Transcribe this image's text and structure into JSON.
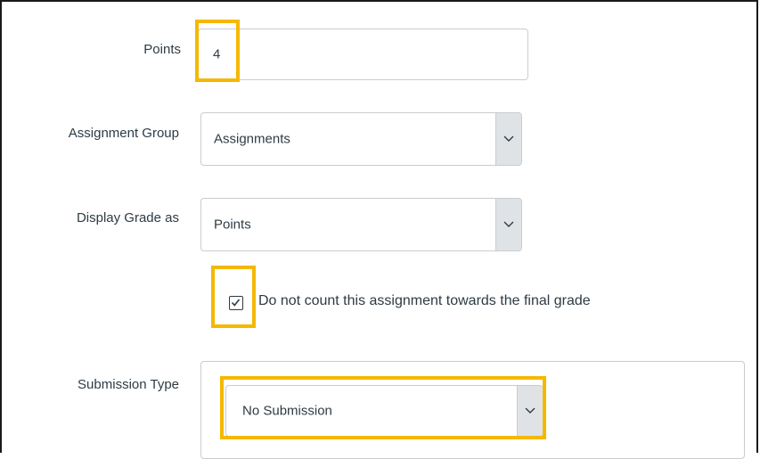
{
  "form": {
    "points": {
      "label": "Points",
      "value": "4"
    },
    "assignment_group": {
      "label": "Assignment Group",
      "selected": "Assignments"
    },
    "display_grade": {
      "label": "Display Grade as",
      "selected": "Points"
    },
    "omit_from_final": {
      "label": "Do not count this assignment towards the final grade",
      "checked": true
    },
    "submission_type": {
      "label": "Submission Type",
      "selected": "No Submission"
    }
  },
  "icons": {
    "select_arrow": "chevron-down-icon",
    "checkbox": "checkmark-icon"
  },
  "colors": {
    "highlight": "#f5b800",
    "text": "#2d3b45",
    "border": "#c7cdd1",
    "select_button": "#e0e3e6"
  }
}
